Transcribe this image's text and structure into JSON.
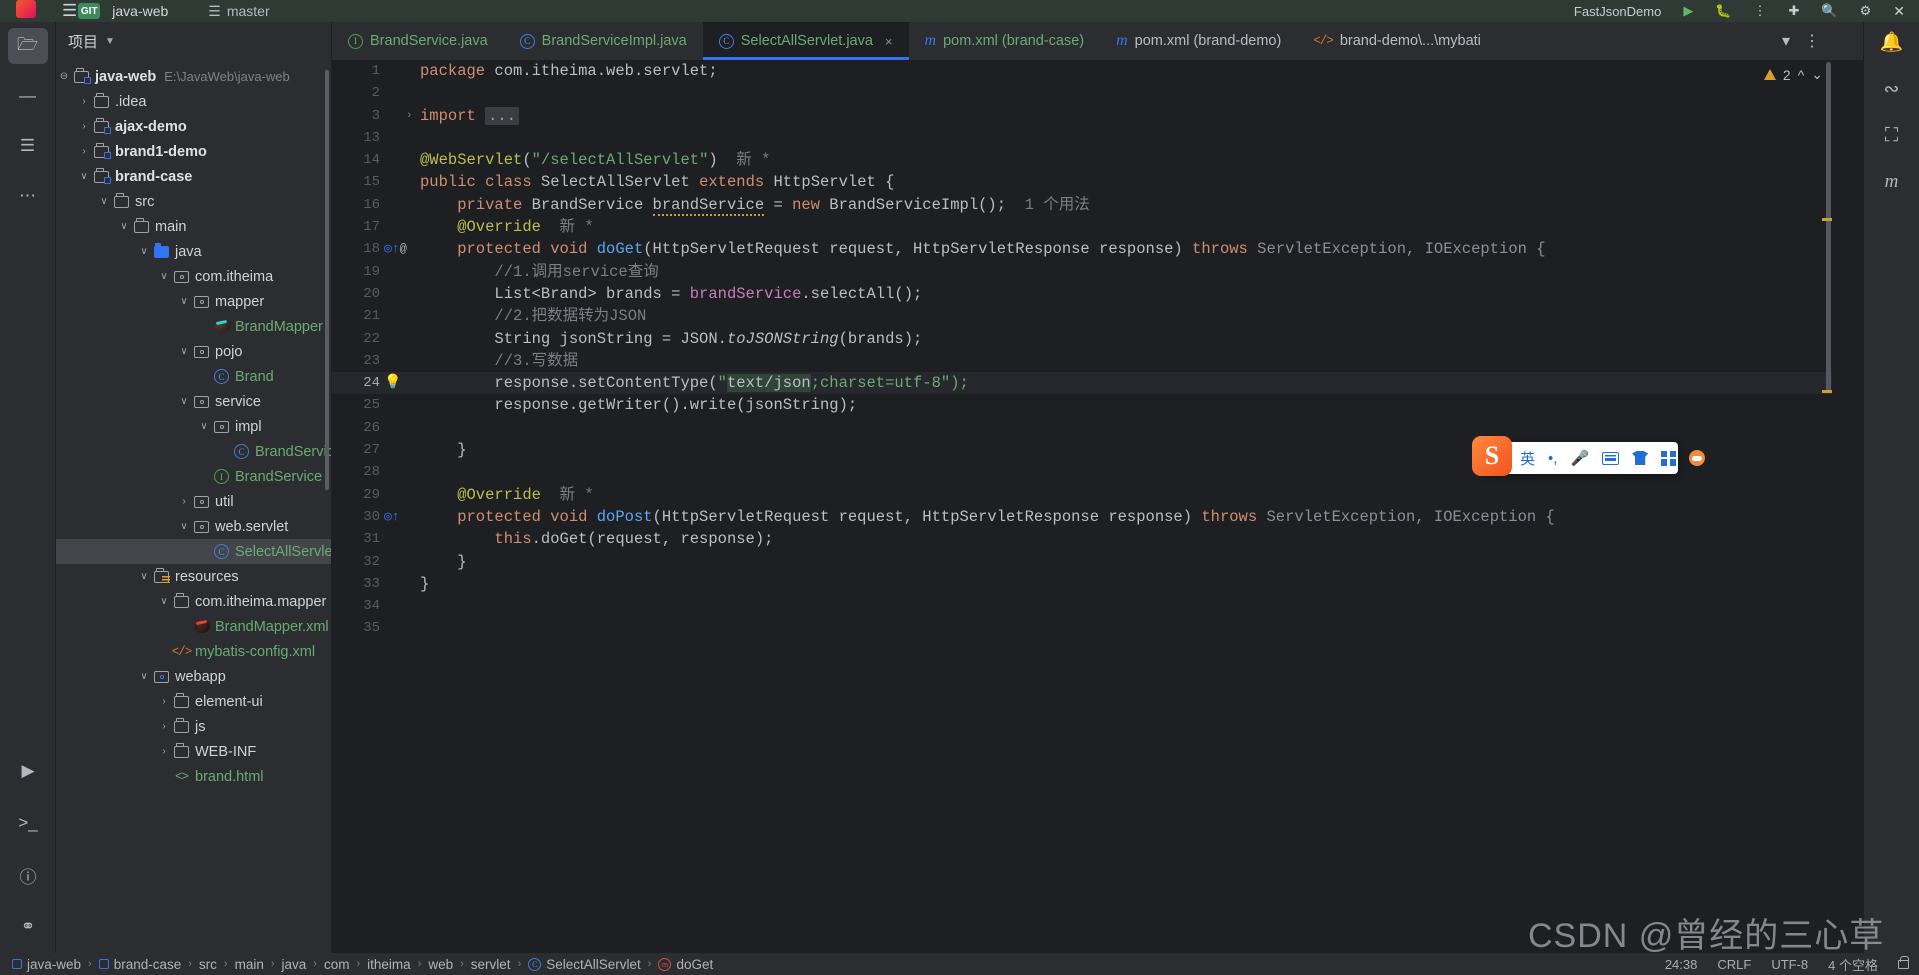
{
  "window": {
    "menu_icon": "hamburger-icon",
    "project_name": "java-web",
    "branch": "master",
    "run_config": "FastJsonDemo",
    "git_badge": "GIT"
  },
  "project_panel": {
    "title": "项目",
    "root": {
      "label": "java-web",
      "path": "E:\\JavaWeb\\java-web"
    },
    "items": [
      {
        "label": ".idea",
        "indent": 1,
        "twist": "collapsed",
        "icon": "folder-icon",
        "style": "plain"
      },
      {
        "label": "ajax-demo",
        "indent": 1,
        "twist": "collapsed",
        "icon": "module-folder-icon",
        "style": "bold"
      },
      {
        "label": "brand1-demo",
        "indent": 1,
        "twist": "collapsed",
        "icon": "module-folder-icon",
        "style": "bold"
      },
      {
        "label": "brand-case",
        "indent": 1,
        "twist": "expanded",
        "icon": "module-folder-icon",
        "style": "bold"
      },
      {
        "label": "src",
        "indent": 2,
        "twist": "expanded",
        "icon": "folder-icon",
        "style": "plain"
      },
      {
        "label": "main",
        "indent": 3,
        "twist": "expanded",
        "icon": "folder-icon",
        "style": "plain"
      },
      {
        "label": "java",
        "indent": 4,
        "twist": "expanded",
        "icon": "source-folder-icon",
        "style": "plain"
      },
      {
        "label": "com.itheima",
        "indent": 5,
        "twist": "expanded",
        "icon": "package-icon",
        "style": "plain"
      },
      {
        "label": "mapper",
        "indent": 6,
        "twist": "expanded",
        "icon": "package-icon",
        "style": "plain"
      },
      {
        "label": "BrandMapper",
        "indent": 7,
        "twist": "none",
        "icon": "mybatis-mapper-icon",
        "style": "green"
      },
      {
        "label": "pojo",
        "indent": 6,
        "twist": "expanded",
        "icon": "package-icon",
        "style": "plain"
      },
      {
        "label": "Brand",
        "indent": 7,
        "twist": "none",
        "icon": "java-class-icon",
        "style": "green"
      },
      {
        "label": "service",
        "indent": 6,
        "twist": "expanded",
        "icon": "package-icon",
        "style": "plain"
      },
      {
        "label": "impl",
        "indent": 7,
        "twist": "expanded",
        "icon": "package-icon",
        "style": "plain"
      },
      {
        "label": "BrandServiceImpl",
        "indent": 8,
        "twist": "none",
        "icon": "java-class-icon",
        "style": "green"
      },
      {
        "label": "BrandService",
        "indent": 7,
        "twist": "none",
        "icon": "java-interface-icon",
        "style": "green"
      },
      {
        "label": "util",
        "indent": 6,
        "twist": "collapsed",
        "icon": "package-icon",
        "style": "plain"
      },
      {
        "label": "web.servlet",
        "indent": 6,
        "twist": "expanded",
        "icon": "package-icon",
        "style": "plain"
      },
      {
        "label": "SelectAllServlet",
        "indent": 7,
        "twist": "none",
        "icon": "java-class-icon",
        "style": "green",
        "selected": true
      },
      {
        "label": "resources",
        "indent": 4,
        "twist": "expanded",
        "icon": "resources-folder-icon",
        "style": "plain"
      },
      {
        "label": "com.itheima.mapper",
        "indent": 5,
        "twist": "expanded",
        "icon": "folder-icon",
        "style": "plain"
      },
      {
        "label": "BrandMapper.xml",
        "indent": 6,
        "twist": "none",
        "icon": "mybatis-xml-icon",
        "style": "green"
      },
      {
        "label": "mybatis-config.xml",
        "indent": 5,
        "twist": "none",
        "icon": "xml-file-icon",
        "style": "green"
      },
      {
        "label": "webapp",
        "indent": 4,
        "twist": "expanded",
        "icon": "webapp-folder-icon",
        "style": "plain"
      },
      {
        "label": "element-ui",
        "indent": 5,
        "twist": "collapsed",
        "icon": "folder-icon",
        "style": "plain"
      },
      {
        "label": "js",
        "indent": 5,
        "twist": "collapsed",
        "icon": "folder-icon",
        "style": "plain"
      },
      {
        "label": "WEB-INF",
        "indent": 5,
        "twist": "collapsed",
        "icon": "folder-icon",
        "style": "plain"
      },
      {
        "label": "brand.html",
        "indent": 5,
        "twist": "none",
        "icon": "html-file-icon",
        "style": "green"
      }
    ]
  },
  "tabs": [
    {
      "label": "BrandService.java",
      "icon": "java-interface-icon",
      "color": "green",
      "active": false
    },
    {
      "label": "BrandServiceImpl.java",
      "icon": "java-class-icon",
      "color": "green",
      "active": false
    },
    {
      "label": "SelectAllServlet.java",
      "icon": "java-class-icon",
      "color": "green",
      "active": true,
      "close": "×"
    },
    {
      "label": "pom.xml (brand-case)",
      "icon": "maven-icon",
      "color": "green",
      "active": false
    },
    {
      "label": "pom.xml (brand-demo)",
      "icon": "maven-icon",
      "color": "grey",
      "active": false
    },
    {
      "label": "brand-demo\\...\\mybati",
      "icon": "xml-file-icon",
      "color": "grey",
      "active": false
    }
  ],
  "editor": {
    "warning_count": "2",
    "lines": [
      {
        "n": "1",
        "gutter": "",
        "segs": [
          {
            "t": "package ",
            "c": "k"
          },
          {
            "t": "com.itheima.web.servlet;",
            "c": "t"
          }
        ]
      },
      {
        "n": "2",
        "gutter": "",
        "segs": []
      },
      {
        "n": "3",
        "gutter": "",
        "fold": "›",
        "segs": [
          {
            "t": "import ",
            "c": "k"
          },
          {
            "t": "...",
            "c": "import-fold"
          }
        ]
      },
      {
        "n": "13",
        "gutter": "",
        "segs": []
      },
      {
        "n": "14",
        "gutter": "",
        "segs": [
          {
            "t": "@WebServlet",
            "c": "a"
          },
          {
            "t": "(",
            "c": "t"
          },
          {
            "t": "\"/selectAllServlet\"",
            "c": "s"
          },
          {
            "t": ")",
            "c": "t"
          },
          {
            "t": "  新 *",
            "c": "c"
          }
        ]
      },
      {
        "n": "15",
        "gutter": "",
        "segs": [
          {
            "t": "public class ",
            "c": "k"
          },
          {
            "t": "SelectAllServlet ",
            "c": "t"
          },
          {
            "t": "extends ",
            "c": "k"
          },
          {
            "t": "HttpServlet {",
            "c": "t"
          }
        ]
      },
      {
        "n": "16",
        "gutter": "",
        "segs": [
          {
            "t": "    private ",
            "c": "k"
          },
          {
            "t": "BrandService ",
            "c": "t"
          },
          {
            "t": "brandService",
            "c": "u-warn"
          },
          {
            "t": " = ",
            "c": "t"
          },
          {
            "t": "new ",
            "c": "k"
          },
          {
            "t": "BrandServiceImpl();",
            "c": "t"
          },
          {
            "t": "  1 个用法",
            "c": "c"
          }
        ]
      },
      {
        "n": "17",
        "gutter": "",
        "segs": [
          {
            "t": "    @Override",
            "c": "a"
          },
          {
            "t": "  新 *",
            "c": "c"
          }
        ]
      },
      {
        "n": "18",
        "gutter": "target-at",
        "segs": [
          {
            "t": "    protected void ",
            "c": "k"
          },
          {
            "t": "doGet",
            "c": "m"
          },
          {
            "t": "(HttpServletRequest request, HttpServletResponse response) ",
            "c": "t"
          },
          {
            "t": "throws ",
            "c": "k"
          },
          {
            "t": "ServletException, IOException {",
            "c": "ex"
          }
        ]
      },
      {
        "n": "19",
        "gutter": "",
        "segs": [
          {
            "t": "        //1.调用service查询",
            "c": "c"
          }
        ]
      },
      {
        "n": "20",
        "gutter": "",
        "segs": [
          {
            "t": "        List<Brand> brands = ",
            "c": "t"
          },
          {
            "t": "brandService",
            "c": "f"
          },
          {
            "t": ".selectAll();",
            "c": "t"
          }
        ]
      },
      {
        "n": "21",
        "gutter": "",
        "segs": [
          {
            "t": "        //2.把数据转为JSON",
            "c": "c"
          }
        ]
      },
      {
        "n": "22",
        "gutter": "",
        "segs": [
          {
            "t": "        String jsonString = JSON.",
            "c": "t"
          },
          {
            "t": "toJSONString",
            "c": "it"
          },
          {
            "t": "(brands);",
            "c": "t"
          }
        ]
      },
      {
        "n": "23",
        "gutter": "",
        "segs": [
          {
            "t": "        //3.写数据",
            "c": "c"
          }
        ]
      },
      {
        "n": "24",
        "gutter": "bulb",
        "current": true,
        "segs": [
          {
            "t": "        response.setContentType(",
            "c": "t"
          },
          {
            "t": "\"",
            "c": "s"
          },
          {
            "t": "text/json",
            "c": "hl-sel"
          },
          {
            "t": ";charset=utf-8\");",
            "c": "s"
          }
        ]
      },
      {
        "n": "25",
        "gutter": "",
        "segs": [
          {
            "t": "        response.getWriter().write(jsonString);",
            "c": "t"
          }
        ]
      },
      {
        "n": "26",
        "gutter": "",
        "segs": []
      },
      {
        "n": "27",
        "gutter": "",
        "segs": [
          {
            "t": "    }",
            "c": "t"
          }
        ]
      },
      {
        "n": "28",
        "gutter": "",
        "segs": []
      },
      {
        "n": "29",
        "gutter": "",
        "segs": [
          {
            "t": "    @Override",
            "c": "a"
          },
          {
            "t": "  新 *",
            "c": "c"
          }
        ]
      },
      {
        "n": "30",
        "gutter": "target",
        "segs": [
          {
            "t": "    protected void ",
            "c": "k"
          },
          {
            "t": "doPost",
            "c": "m"
          },
          {
            "t": "(HttpServletRequest request, HttpServletResponse response) ",
            "c": "t"
          },
          {
            "t": "throws ",
            "c": "k"
          },
          {
            "t": "ServletException, IOException {",
            "c": "ex"
          }
        ]
      },
      {
        "n": "31",
        "gutter": "",
        "segs": [
          {
            "t": "        this",
            "c": "k"
          },
          {
            "t": ".doGet(request, response);",
            "c": "t"
          }
        ]
      },
      {
        "n": "32",
        "gutter": "",
        "segs": [
          {
            "t": "    }",
            "c": "t"
          }
        ]
      },
      {
        "n": "33",
        "gutter": "",
        "segs": [
          {
            "t": "}",
            "c": "t"
          }
        ]
      },
      {
        "n": "34",
        "gutter": "",
        "segs": []
      },
      {
        "n": "35",
        "gutter": "",
        "segs": []
      }
    ]
  },
  "ime": {
    "logo": "sogou-logo",
    "mode": "英",
    "punct": "•,",
    "icons": [
      "microphone-icon",
      "keyboard-icon",
      "skin-icon",
      "apps-grid-icon",
      "mascot-icon"
    ]
  },
  "watermark": "CSDN @曾经的三心草",
  "status_bar": {
    "breadcrumbs": [
      {
        "label": "java-web",
        "icon": "module-icon"
      },
      {
        "label": "brand-case",
        "icon": "module-icon"
      },
      {
        "label": "src",
        "icon": ""
      },
      {
        "label": "main",
        "icon": ""
      },
      {
        "label": "java",
        "icon": ""
      },
      {
        "label": "com",
        "icon": ""
      },
      {
        "label": "itheima",
        "icon": ""
      },
      {
        "label": "web",
        "icon": ""
      },
      {
        "label": "servlet",
        "icon": ""
      },
      {
        "label": "SelectAllServlet",
        "icon": "class-icon"
      },
      {
        "label": "doGet",
        "icon": "method-icon"
      }
    ],
    "caret": "24:38",
    "line_sep": "CRLF",
    "encoding": "UTF-8",
    "indent": "4 个空格",
    "lock": "unlocked-icon"
  },
  "colors": {
    "accent": "#3574f0",
    "string": "#6aab73",
    "keyword": "#cf8e6d",
    "bg_editor": "#1e1f22",
    "bg_panel": "#2b2d30"
  }
}
